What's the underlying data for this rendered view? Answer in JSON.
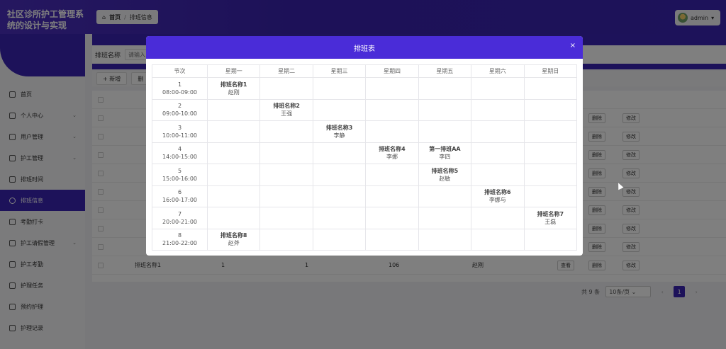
{
  "app": {
    "title": "社区诊所护工管理系统的设计与实现",
    "user": "admin"
  },
  "breadcrumb": {
    "home": "首页",
    "current": "排班信息"
  },
  "sidebar": {
    "items": [
      {
        "label": "首页",
        "icon": "home-icon",
        "expandable": false,
        "active": false
      },
      {
        "label": "个人中心",
        "icon": "user-icon",
        "expandable": true,
        "active": false
      },
      {
        "label": "用户管理",
        "icon": "users-icon",
        "expandable": true,
        "active": false
      },
      {
        "label": "护工管理",
        "icon": "nurse-icon",
        "expandable": true,
        "active": false
      },
      {
        "label": "排班时间",
        "icon": "clock-icon",
        "expandable": false,
        "active": false
      },
      {
        "label": "排班信息",
        "icon": "schedule-icon",
        "expandable": false,
        "active": true
      },
      {
        "label": "考勤打卡",
        "icon": "checkin-icon",
        "expandable": false,
        "active": false
      },
      {
        "label": "护工请假管理",
        "icon": "leave-icon",
        "expandable": true,
        "active": false
      },
      {
        "label": "护工考勤",
        "icon": "attendance-icon",
        "expandable": false,
        "active": false
      },
      {
        "label": "护理任务",
        "icon": "task-icon",
        "expandable": false,
        "active": false
      },
      {
        "label": "预约护理",
        "icon": "booking-icon",
        "expandable": false,
        "active": false
      },
      {
        "label": "护理记录",
        "icon": "record-icon",
        "expandable": false,
        "active": false
      }
    ]
  },
  "search": {
    "label": "排班名称",
    "placeholder": "请输入"
  },
  "toolbar": {
    "add_label": "+ 新增",
    "delete_label": "删"
  },
  "list": {
    "rows": [
      {
        "name": "排班名称1",
        "col2": "1",
        "col3": "1",
        "col4": "106",
        "person": "赵刚"
      }
    ],
    "row_actions": {
      "view": "查看",
      "delete": "删除",
      "edit": "修改"
    }
  },
  "pager": {
    "total": "共 9 条",
    "page_size": "10条/页",
    "current_page": "1"
  },
  "modal": {
    "title": "排班表",
    "close_label": "×",
    "headers": [
      "节次",
      "星期一",
      "星期二",
      "星期三",
      "星期四",
      "星期五",
      "星期六",
      "星期日"
    ],
    "rows": [
      {
        "num": "1",
        "time": "08:00-09:00",
        "cells": [
          {
            "name": "排班名称1",
            "person": "赵刚"
          },
          null,
          null,
          null,
          null,
          null,
          null
        ]
      },
      {
        "num": "2",
        "time": "09:00-10:00",
        "cells": [
          null,
          {
            "name": "排班名称2",
            "person": "王强"
          },
          null,
          null,
          null,
          null,
          null
        ]
      },
      {
        "num": "3",
        "time": "10:00-11:00",
        "cells": [
          null,
          null,
          {
            "name": "排班名称3",
            "person": "李静"
          },
          null,
          null,
          null,
          null
        ]
      },
      {
        "num": "4",
        "time": "14:00-15:00",
        "cells": [
          null,
          null,
          null,
          {
            "name": "排班名称4",
            "person": "李娜"
          },
          {
            "name": "第一排班AA",
            "person": "李四"
          },
          null,
          null
        ]
      },
      {
        "num": "5",
        "time": "15:00-16:00",
        "cells": [
          null,
          null,
          null,
          null,
          {
            "name": "排班名称5",
            "person": "赵敏"
          },
          null,
          null
        ]
      },
      {
        "num": "6",
        "time": "16:00-17:00",
        "cells": [
          null,
          null,
          null,
          null,
          null,
          {
            "name": "排班名称6",
            "person": "李娜与"
          },
          null
        ]
      },
      {
        "num": "7",
        "time": "20:00-21:00",
        "cells": [
          null,
          null,
          null,
          null,
          null,
          null,
          {
            "name": "排班名称7",
            "person": "王磊"
          }
        ]
      },
      {
        "num": "8",
        "time": "21:00-22:00",
        "cells": [
          {
            "name": "排班名称8",
            "person": "赵斧"
          },
          null,
          null,
          null,
          null,
          null,
          null
        ]
      }
    ]
  }
}
